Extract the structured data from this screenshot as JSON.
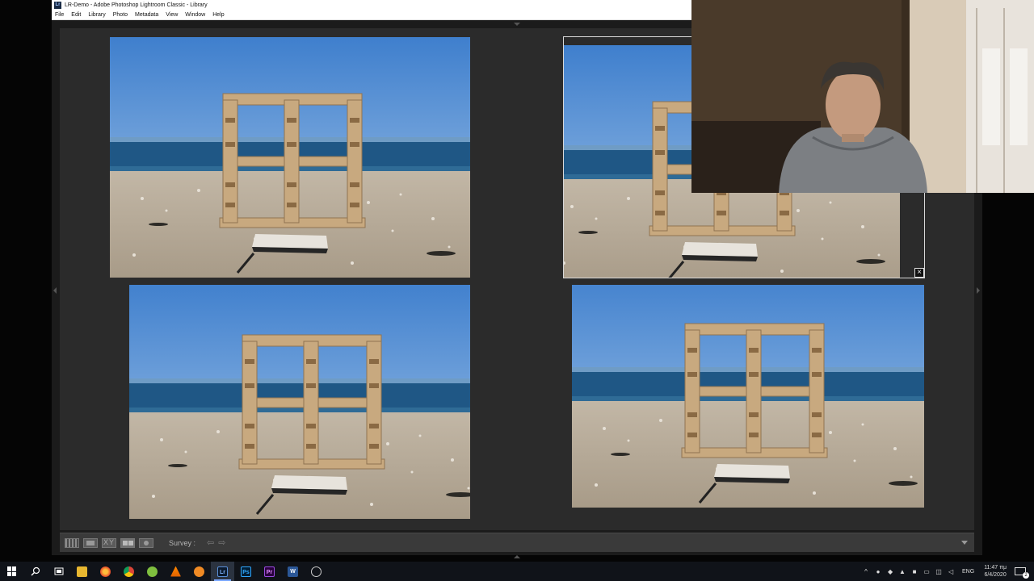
{
  "window": {
    "app_icon": "Lr",
    "title": "LR-Demo - Adobe Photoshop Lightroom Classic - Library"
  },
  "menu": [
    "File",
    "Edit",
    "Library",
    "Photo",
    "Metadata",
    "View",
    "Window",
    "Help"
  ],
  "toolbar": {
    "survey_label": "Survey :",
    "prev_arrow": "⇦",
    "next_arrow": "⇨"
  },
  "photo_close": "×",
  "taskbar": {
    "items": [
      "start",
      "search",
      "task-view",
      "file-explorer",
      "firefox",
      "chrome",
      "greenshot",
      "vlc",
      "photos",
      "lightroom",
      "photoshop",
      "premiere",
      "word",
      "obs"
    ],
    "lightroom_label": "Lr",
    "photoshop_label": "Ps",
    "premiere_label": "Pr",
    "word_label": "W"
  },
  "tray": {
    "chevron": "^",
    "language": "ENG",
    "time": "11:47 πμ",
    "date": "6/4/2020",
    "notification_count": "2"
  },
  "colors": {
    "workspace": "#1b1b1b",
    "survey_bg": "#2b2b2b",
    "toolbar": "#3a3a3a",
    "taskbar": "#101319",
    "sky_top": "#4b86cf",
    "sea": "#2b5f8e",
    "sand": "#b9ad9c",
    "wood": "#c9a77c"
  }
}
